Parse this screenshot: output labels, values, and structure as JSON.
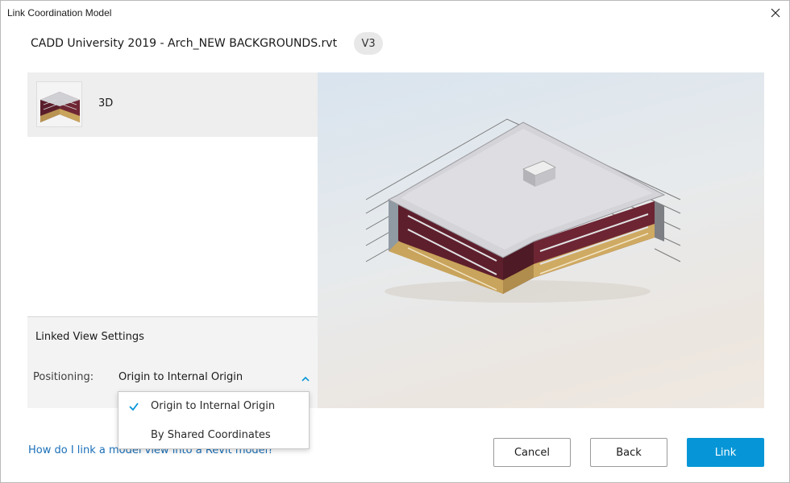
{
  "window": {
    "title": "Link Coordination Model"
  },
  "header": {
    "file_name": "CADD University 2019 - Arch_NEW BACKGROUNDS.rvt",
    "version": "V3"
  },
  "views": [
    {
      "label": "3D"
    }
  ],
  "settings": {
    "heading": "Linked View Settings",
    "positioning_label": "Positioning:",
    "positioning_value": "Origin to Internal Origin",
    "options": [
      {
        "label": "Origin to Internal Origin",
        "selected": true
      },
      {
        "label": "By Shared Coordinates",
        "selected": false
      }
    ]
  },
  "footer": {
    "help_link": "How do I link a model view into a Revit model?",
    "cancel_label": "Cancel",
    "back_label": "Back",
    "link_label": "Link"
  },
  "colors": {
    "accent": "#0696d7",
    "link": "#1a6fb8",
    "brick": "#6b2230",
    "stone": "#c9a45c",
    "roof": "#d3d3d8"
  }
}
